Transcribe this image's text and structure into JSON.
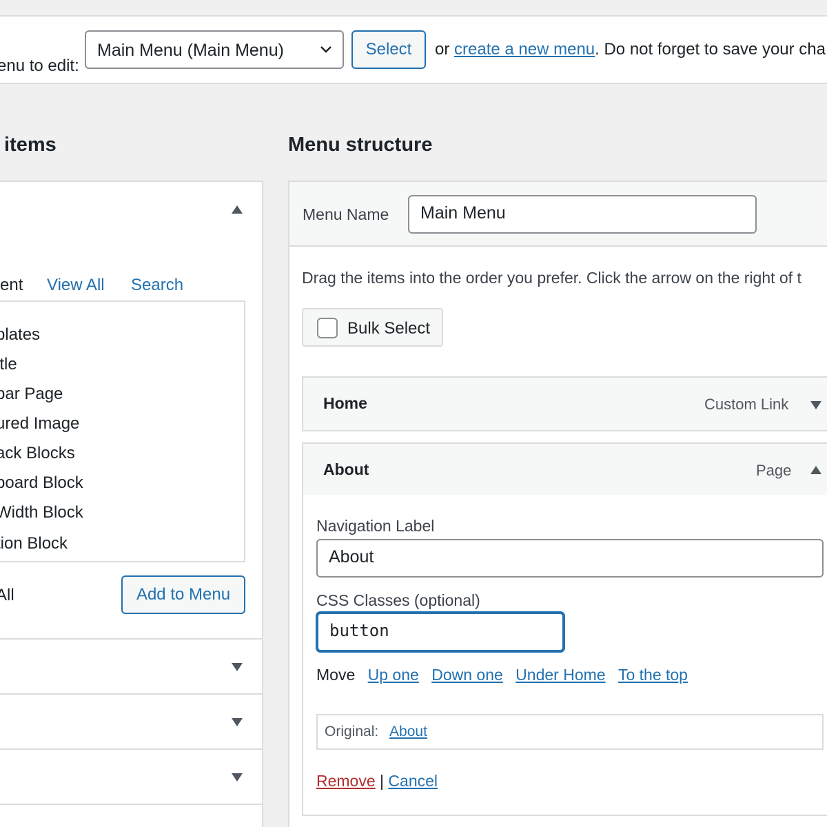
{
  "manage": {
    "label": "enu to edit:",
    "selected_menu": "Main Menu (Main Menu)",
    "select_button": "Select",
    "hint_prefix": "or ",
    "create_link": "create a new menu",
    "hint_suffix": ". Do not forget to save your cha"
  },
  "left": {
    "heading": " items",
    "tabs": {
      "recent": "ent",
      "view_all": "View All",
      "search": "Search"
    },
    "items": [
      "plates",
      "itle",
      "bar Page",
      "ured Image",
      "ack Blocks",
      "board Block",
      " Width Block",
      "tion Block"
    ],
    "select_all": "All",
    "add_button": "Add to Menu"
  },
  "structure": {
    "heading": "Menu structure",
    "menu_name_label": "Menu Name",
    "menu_name_value": "Main Menu",
    "instructions": "Drag the items into the order you prefer. Click the arrow on the right of t",
    "bulk_select": "Bulk Select",
    "items": [
      {
        "title": "Home",
        "type": "Custom Link"
      },
      {
        "title": "About",
        "type": "Page"
      }
    ],
    "settings": {
      "nav_label_label": "Navigation Label",
      "nav_label_value": "About",
      "css_label": "CSS Classes (optional)",
      "css_value": "button",
      "move_label": "Move",
      "move_up": "Up one",
      "move_down": "Down one",
      "move_under": "Under Home",
      "move_top": "To the top",
      "original_label": "Original:",
      "original_link": "About",
      "remove": "Remove",
      "separator": "|",
      "cancel": "Cancel"
    }
  },
  "colors": {
    "link": "#2271b1",
    "danger": "#b32d2e",
    "border": "#dcdcde",
    "bg": "#f0f0f1"
  }
}
